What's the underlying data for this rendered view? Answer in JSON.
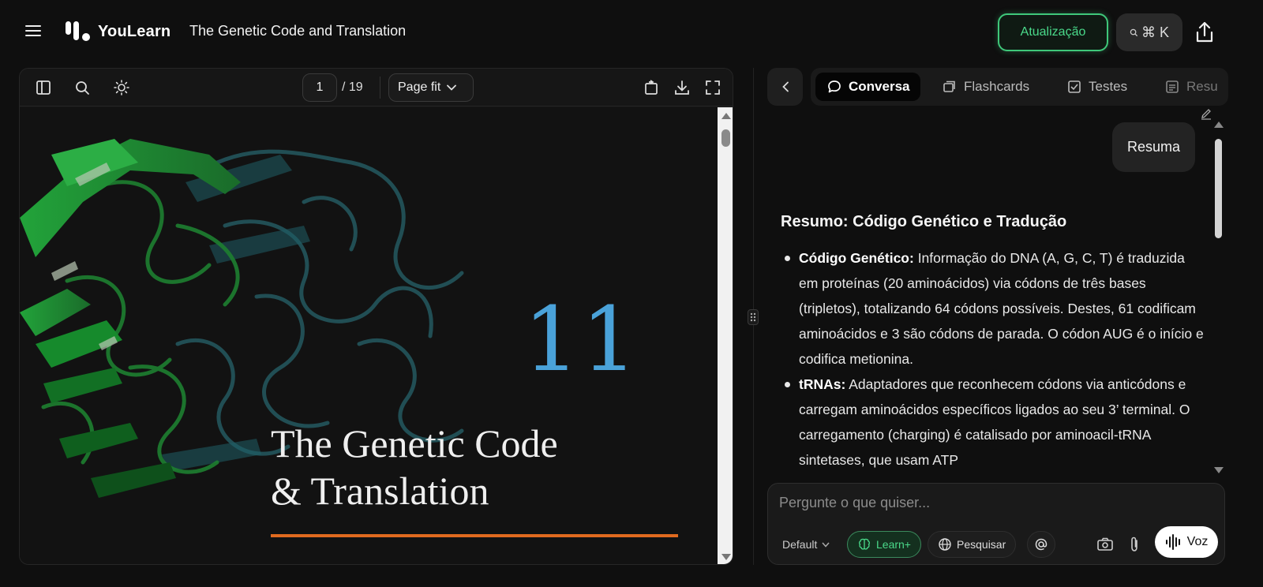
{
  "header": {
    "app_name": "YouLearn",
    "document_title": "The Genetic Code and Translation",
    "upgrade_label": "Atualização",
    "search_shortcut": "⌘ K",
    "accent_color": "#3fc77a"
  },
  "viewer": {
    "current_page": "1",
    "total_pages": "/ 19",
    "zoom": "Page fit",
    "page": {
      "chapter_number": "11",
      "title_line1": "The Genetic Code",
      "title_line2": "& Translation",
      "chapter_color": "#4aa2d9",
      "rule_color": "#e06a1f"
    }
  },
  "chat": {
    "tabs": [
      {
        "label": "Conversa",
        "icon": "chat-bubble-icon"
      },
      {
        "label": "Flashcards",
        "icon": "cards-icon"
      },
      {
        "label": "Testes",
        "icon": "quiz-icon"
      },
      {
        "label": "Resu",
        "icon": "summary-icon"
      }
    ],
    "user_message": "Resuma",
    "response": {
      "heading": "Resumo: Código Genético e Tradução",
      "items": [
        {
          "term": "Código Genético:",
          "text": " Informação do DNA (A, G, C, T) é traduzida em proteínas (20 aminoácidos) via códons de três bases (tripletos), totalizando 64 códons possíveis. Destes, 61 codificam aminoácidos e 3 são códons de parada. O códon AUG é o início e codifica metionina."
        },
        {
          "term": "tRNAs:",
          "text": " Adaptadores que reconhecem códons via anticódons e carregam aminoácidos específicos ligados ao seu 3’ terminal. O carregamento (charging) é catalisado por aminoacil-tRNA sintetases, que usam ATP"
        }
      ]
    },
    "composer": {
      "placeholder": "Pergunte o que quiser...",
      "model": "Default",
      "learn_label": "Learn+",
      "search_label": "Pesquisar",
      "voice_label": "Voz"
    }
  }
}
